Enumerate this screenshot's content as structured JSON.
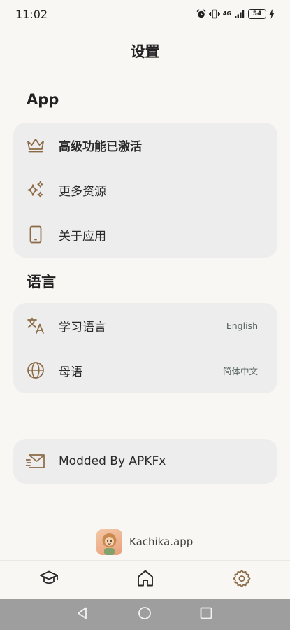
{
  "status_bar": {
    "time": "11:02",
    "network": "4G",
    "battery": "54"
  },
  "page": {
    "title": "设置"
  },
  "sections": {
    "app": {
      "title": "App",
      "items": [
        {
          "label": "高级功能已激活",
          "icon": "crown-icon"
        },
        {
          "label": "更多资源",
          "icon": "sparkles-icon"
        },
        {
          "label": "关于应用",
          "icon": "phone-icon"
        }
      ]
    },
    "language": {
      "title": "语言",
      "items": [
        {
          "label": "学习语言",
          "value": "English",
          "icon": "translate-icon"
        },
        {
          "label": "母语",
          "value": "简体中文",
          "icon": "globe-icon"
        }
      ]
    },
    "mod": {
      "items": [
        {
          "label": "Modded By APKFx",
          "icon": "mail-icon"
        }
      ]
    }
  },
  "brand": {
    "name": "Kachika.app"
  },
  "bottom_nav": {
    "items": [
      {
        "icon": "graduation-cap-icon"
      },
      {
        "icon": "home-icon"
      },
      {
        "icon": "gear-icon"
      }
    ]
  },
  "colors": {
    "background": "#f9f7f3",
    "card": "#ededed",
    "accent_icon": "#8b6a45",
    "value_text": "#55625d",
    "system_nav": "#9e9e9e"
  }
}
